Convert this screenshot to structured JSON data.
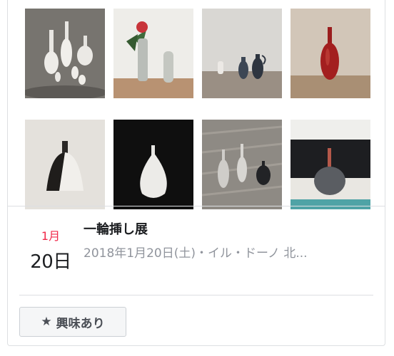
{
  "event": {
    "month": "1月",
    "day": "20日",
    "title": "一輪挿し展",
    "details": "2018年1月20日(土)・イル・ドーノ 北..."
  },
  "actions": {
    "interest_label": "興味あり",
    "interest_icon": "star-icon"
  },
  "photos": [
    {
      "name": "photo-white-vases-on-stone"
    },
    {
      "name": "photo-vases-with-red-flower"
    },
    {
      "name": "photo-small-dark-jugs"
    },
    {
      "name": "photo-red-bottle-vase"
    },
    {
      "name": "photo-black-white-bell-vase"
    },
    {
      "name": "photo-white-vase-on-black"
    },
    {
      "name": "photo-grey-vases-on-wood"
    },
    {
      "name": "photo-grey-bottle-vase"
    }
  ],
  "colors": {
    "month": "#f02849",
    "title": "#1c1e21",
    "subtext": "#90949c",
    "border": "#dddfe2"
  }
}
